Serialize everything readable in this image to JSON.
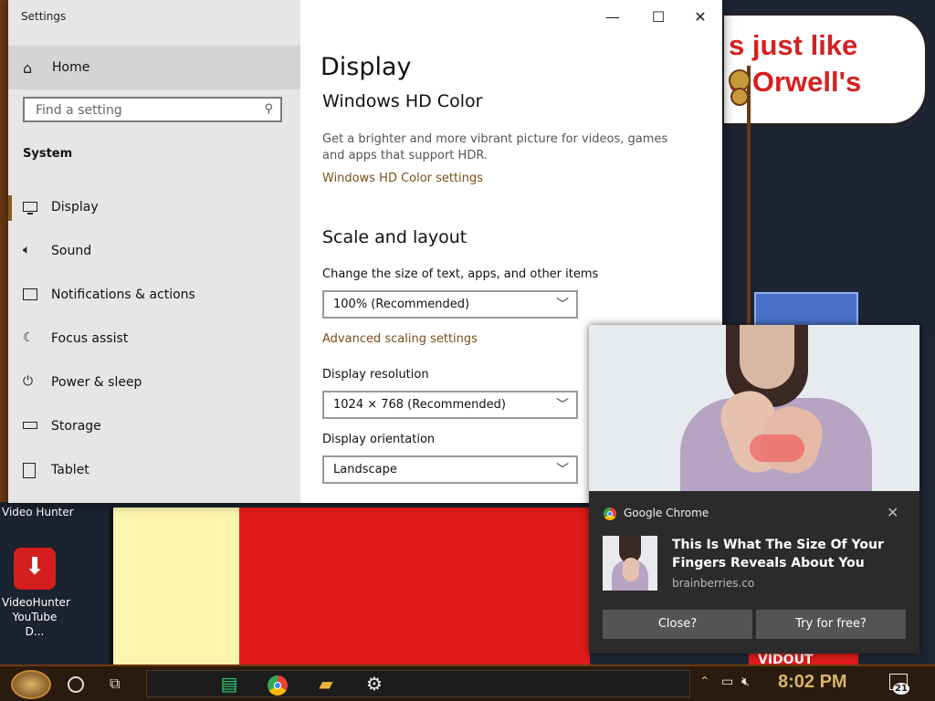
{
  "window": {
    "title": "Settings",
    "minimize": "—",
    "maximize": "☐",
    "close": "✕"
  },
  "sidebar": {
    "home": "Home",
    "search_placeholder": "Find a setting",
    "section": "System",
    "items": [
      {
        "label": "Display",
        "icon": "monitor-icon",
        "active": true
      },
      {
        "label": "Sound",
        "icon": "speaker-icon"
      },
      {
        "label": "Notifications & actions",
        "icon": "chat-icon"
      },
      {
        "label": "Focus assist",
        "icon": "moon-icon"
      },
      {
        "label": "Power & sleep",
        "icon": "power-icon"
      },
      {
        "label": "Storage",
        "icon": "storage-icon"
      },
      {
        "label": "Tablet",
        "icon": "tablet-icon"
      }
    ]
  },
  "content": {
    "page_title": "Display",
    "hd_color": {
      "heading": "Windows HD Color",
      "description": "Get a brighter and more vibrant picture for videos, games and apps that support HDR.",
      "link": "Windows HD Color settings"
    },
    "scale_layout": {
      "heading": "Scale and layout",
      "size_label": "Change the size of text, apps, and other items",
      "size_value": "100% (Recommended)",
      "advanced_link": "Advanced scaling settings",
      "resolution_label": "Display resolution",
      "resolution_value": "1024 × 768 (Recommended)",
      "orientation_label": "Display orientation",
      "orientation_value": "Landscape"
    }
  },
  "notification": {
    "app": "Google Chrome",
    "title": "This Is What The Size Of Your Fingers Reveals About You",
    "source": "brainberries.co",
    "btn_close": "Close?",
    "btn_try": "Try for free?"
  },
  "desktop": {
    "bubble_line1": "s just like",
    "bubble_line2": "e Orwell's",
    "icon_top_label": "Video Hunter",
    "icon_label_1": "VideoHunter",
    "icon_label_2": "YouTube D...",
    "wall_text": "VIDOUT"
  },
  "taskbar": {
    "time": "8:02 PM",
    "notification_count": "21"
  },
  "colors": {
    "accent": "#7a4f18",
    "chrome_bg": "#2b2b2b",
    "taskbar_clock": "#d9b467"
  }
}
